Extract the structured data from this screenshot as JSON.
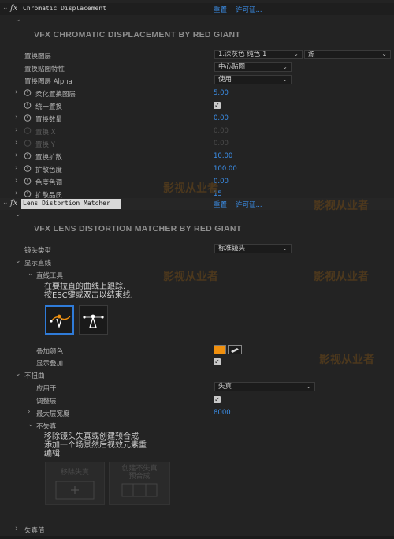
{
  "effect1": {
    "icon": "fx",
    "name": "Chromatic Displacement",
    "reset": "重置",
    "license": "许可证...",
    "banner": "VFX CHROMATIC DISPLACEMENT BY RED GIANT",
    "params": {
      "disp_layer": {
        "label": "置换图层",
        "value1": "1.深灰色 纯色 1",
        "value2": "源"
      },
      "disp_map_behavior": {
        "label": "置换贴图特性",
        "value": "中心贴图"
      },
      "disp_alpha": {
        "label": "置换图层 Alpha",
        "value": "使用"
      },
      "soften": {
        "label": "柔化置换图层",
        "value": "5.00"
      },
      "uniform": {
        "label": "统一置换"
      },
      "amount": {
        "label": "置换数量",
        "value": "0.00"
      },
      "disp_x": {
        "label": "置换 X",
        "value": "0.00"
      },
      "disp_y": {
        "label": "置换 Y",
        "value": "0.00"
      },
      "spread": {
        "label": "置换扩散",
        "value": "10.00"
      },
      "spread_color": {
        "label": "扩散色度",
        "value": "100.00"
      },
      "hue": {
        "label": "色度色调",
        "value": "0.00"
      },
      "quality": {
        "label": "扩散品质",
        "value": "15"
      }
    }
  },
  "effect2": {
    "icon": "fx",
    "name": "Lens Distortion Matcher",
    "reset": "重置",
    "license": "许可证...",
    "banner": "VFX LENS DISTORTION MATCHER BY RED GIANT",
    "lens_type": {
      "label": "镜头类型",
      "value": "标准镜头"
    },
    "show_lines": {
      "label": "显示直线"
    },
    "line_tool": {
      "label": "直线工具",
      "help_line1": "在要拉直的曲线上跟踪.",
      "help_line2": "按ESC键或双击以结束线."
    },
    "overlay_color": {
      "label": "叠加颜色",
      "color": "#f0900e"
    },
    "show_overlay": {
      "label": "显示叠加"
    },
    "undistort": {
      "label": "不扭曲"
    },
    "apply_to": {
      "label": "应用于",
      "value": "失真"
    },
    "adjust_layer": {
      "label": "调整层"
    },
    "max_layer_width": {
      "label": "最大层宽度",
      "value": "8000"
    },
    "no_distort": {
      "label": "不失真",
      "help_line1": "移除镜头失真或创建预合成",
      "help_line2": "添加一个场景然后视效元素重",
      "help_line3": "编辑",
      "btn_remove": "移除失真",
      "btn_create_line1": "创建不失真",
      "btn_create_line2": "预合成"
    },
    "distortion_value": {
      "label": "失真值"
    }
  },
  "watermark": {
    "line1": "影视从业者"
  },
  "colors": {
    "accent": "#3b8ee8",
    "selected_tool": "#2f7bd8",
    "swatch": "#f0900e"
  }
}
